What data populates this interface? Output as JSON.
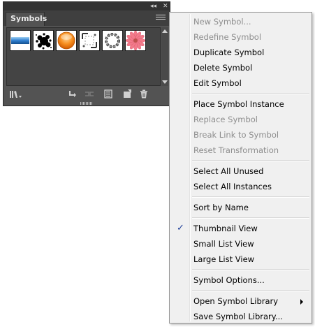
{
  "panel": {
    "tab_label": "Symbols",
    "collapse_glyph": "◂◂",
    "close_glyph": "✕",
    "symbols": [
      {
        "name": "blue-banner"
      },
      {
        "name": "black-splatter"
      },
      {
        "name": "orange-button"
      },
      {
        "name": "corner-frame"
      },
      {
        "name": "chain-ring"
      },
      {
        "name": "pink-flower"
      }
    ],
    "toolbar_icons": [
      "symbol-libraries-icon",
      "place-instance-icon",
      "break-link-icon",
      "symbol-options-icon",
      "new-symbol-icon",
      "delete-icon"
    ]
  },
  "menu": {
    "items": [
      {
        "label": "New Symbol...",
        "disabled": true
      },
      {
        "label": "Redefine Symbol",
        "disabled": true
      },
      {
        "label": "Duplicate Symbol",
        "disabled": false
      },
      {
        "label": "Delete Symbol",
        "disabled": false
      },
      {
        "label": "Edit Symbol",
        "disabled": false
      },
      {
        "label": "Place Symbol Instance",
        "disabled": false
      },
      {
        "label": "Replace Symbol",
        "disabled": true
      },
      {
        "label": "Break Link to Symbol",
        "disabled": true
      },
      {
        "label": "Reset Transformation",
        "disabled": true
      },
      {
        "label": "Select All Unused",
        "disabled": false
      },
      {
        "label": "Select All Instances",
        "disabled": false
      },
      {
        "label": "Sort by Name",
        "disabled": false
      },
      {
        "label": "Thumbnail View",
        "disabled": false,
        "checked": true
      },
      {
        "label": "Small List View",
        "disabled": false
      },
      {
        "label": "Large List View",
        "disabled": false
      },
      {
        "label": "Symbol Options...",
        "disabled": false
      },
      {
        "label": "Open Symbol Library",
        "disabled": false,
        "submenu": true
      },
      {
        "label": "Save Symbol Library...",
        "disabled": false
      }
    ],
    "check_glyph": "✓"
  }
}
